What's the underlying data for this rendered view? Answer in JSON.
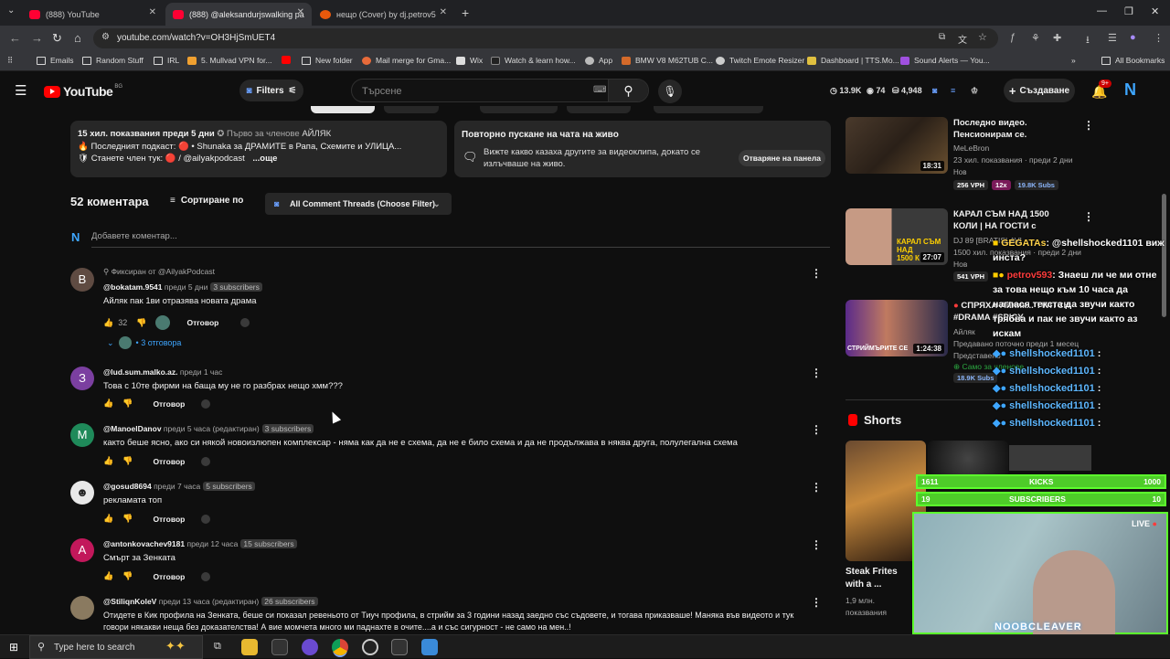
{
  "browser": {
    "tabs": [
      {
        "title": "(888) YouTube",
        "active": false
      },
      {
        "title": "(888) @aleksandurjswalking pa",
        "active": true
      },
      {
        "title": "нещо (Cover) by dj.petrov5",
        "active": false
      }
    ],
    "url": "youtube.com/watch?v=OH3HjSmUET4",
    "bookmarks": [
      "Emails",
      "Random Stuff",
      "IRL",
      "5. Mullvad VPN for...",
      "New folder",
      "Mail merge for Gma...",
      "Wix",
      "Watch & learn how...",
      "App",
      "BMW V8 M62TUB C...",
      "Twitch Emote Resizer",
      "Dashboard | TTS.Mo...",
      "Sound Alerts — You...",
      "All Bookmarks"
    ]
  },
  "header": {
    "logo_text": "YouTube",
    "country": "BG",
    "filters_label": "Filters",
    "search_placeholder": "Търсене",
    "stat_views": "13.9K",
    "stat_likes": "74",
    "stat_subs": "4,948",
    "create_label": "Създаване",
    "notif_count": "9+",
    "avatar_letter": "N"
  },
  "description": {
    "line1": "15 хил. показвания  преди 5 дни",
    "member_badge": "Първо за членове",
    "channel": "АЙЛЯК",
    "line2": "🔥 Последният подкаст: 🔴 • Shunaka за ДРАМИТЕ в Рапа, Схемите и УЛИЦА...",
    "line3": "🛡 Станете член тук: 🔴 / @ailyakpodcast",
    "more": "...още"
  },
  "replay": {
    "title": "Повторно пускане на чата на живо",
    "text": "Вижте какво казаха другите за видеоклипа, докато се излъчваше на живо.",
    "button": "Отваряне на панела"
  },
  "comments_header": {
    "count": "52 коментара",
    "sort": "Сортиране по",
    "filter": "All Comment Threads (Choose Filter)",
    "add_placeholder": "Добавете коментар..."
  },
  "comments": [
    {
      "avatar": "B",
      "pinned": "Фиксиран от @AilyakPodcast",
      "user": "@bokatam.9541",
      "time": "преди 5 дни",
      "subs": "3 subscribers",
      "text": "Айляк пак 1ви отразява новата драма",
      "likes": "32",
      "reply": "Отговор",
      "replies": "3 отговора",
      "color": "#5f4b42"
    },
    {
      "avatar": "З",
      "user": "@lud.sum.malko.az.",
      "time": "преди 1 час",
      "subs": "",
      "text": "Това с 10те фирми на баща му не го разбрах нещо хмм???",
      "reply": "Отговор",
      "color": "#7b3fa0"
    },
    {
      "avatar": "M",
      "user": "@ManoelDanov",
      "time": "преди 5 часа (редактиран)",
      "subs": "3 subscribers",
      "text": "както беше ясно, ако си някой новоизлюпен комплексар - няма как да не е схема, да не е било схема и да не продължава в няква другa, полулегална схема",
      "reply": "Отговор",
      "color": "#1f8a5a"
    },
    {
      "avatar": "",
      "user": "@gosud8694",
      "time": "преди 7 часа",
      "subs": "5 subscribers",
      "text": "рекламата топ",
      "reply": "Отговор",
      "color": "#dddddd"
    },
    {
      "avatar": "A",
      "user": "@antonkovachev9181",
      "time": "преди 12 часа",
      "subs": "15 subscribers",
      "text": "Смърт за Зенката",
      "reply": "Отговор",
      "color": "#c2185b"
    },
    {
      "avatar": "",
      "user": "@StiliqnKoleV",
      "time": "преди 13 часа (редактиран)",
      "subs": "26 subscribers",
      "text": "Отидете в Кик профила на Зенката, беше си показал ревеньото от Тиуч профила, в стрийм за 3 години назад заедно със съдовете, и тогава приказваше! Маняка във видеото и тук",
      "text2": "говори някакви неща без доказателства! А вие момчета много ми паднахте в очите....а и със сигурност - не само на мен..!",
      "color": "#8a7a60"
    }
  ],
  "sidebar": {
    "videos": [
      {
        "title": "Последно видео. Пенсионирам се.",
        "channel": "MeLeBron",
        "stats": "23 хил. показвания · преди 2 дни",
        "badge": "Нов",
        "duration": "18:31",
        "vph": "256 VPH",
        "mult": "12x",
        "subs": "19.8K Subs"
      },
      {
        "title": "КАРАЛ СЪМ НАД 1500 КОЛИ | НА ГОСТИ с",
        "channel": "DJ 89 [BRATISLAV]",
        "stats": "1500 хил. показвания · преди 2 дни",
        "badge": "Нов",
        "duration": "27:07",
        "vph": "541 VPH"
      },
      {
        "title": "СПРЯХА Айляк... TWITCH #DRAMA #SPICY",
        "channel": "Айляк",
        "stats": "Предавано поточно преди 1 месец",
        "badge": "Представено",
        "duration": "1:24:38",
        "members": "Само за членове",
        "subs": "18.9K Subs"
      }
    ],
    "shorts_label": "Shorts",
    "short": {
      "title": "Steak Frites with a ...",
      "views": "1,9 млн. показвания"
    }
  },
  "overlay": {
    "chat": [
      {
        "user": "GEGATAs",
        "msg": ": @shellshocked1101 виж инста?"
      },
      {
        "user": "petrov593",
        "msg": ": Знаеш ли че ми отне за това нещо към 10 часа да наглася текста да звучи както трябва и пак не звучи както аз искам"
      },
      {
        "user": "shellshocked1101",
        "msg": ":"
      },
      {
        "user": "shellshocked1101",
        "msg": ":"
      },
      {
        "user": "shellshocked1101",
        "msg": ":"
      },
      {
        "user": "shellshocked1101",
        "msg": ":"
      },
      {
        "user": "shellshocked1101",
        "msg": ":"
      }
    ],
    "kicks": {
      "label": "KICKS",
      "left": "1611",
      "right": "1000",
      "progress": 1.0
    },
    "subs": {
      "label": "SUBSCRIBERS",
      "left": "19",
      "right": "10",
      "progress": 1.0
    },
    "live_label": "LIVE",
    "streamer_name": "NOOBCLEAVER"
  },
  "taskbar": {
    "search_label": "Type here to search"
  }
}
